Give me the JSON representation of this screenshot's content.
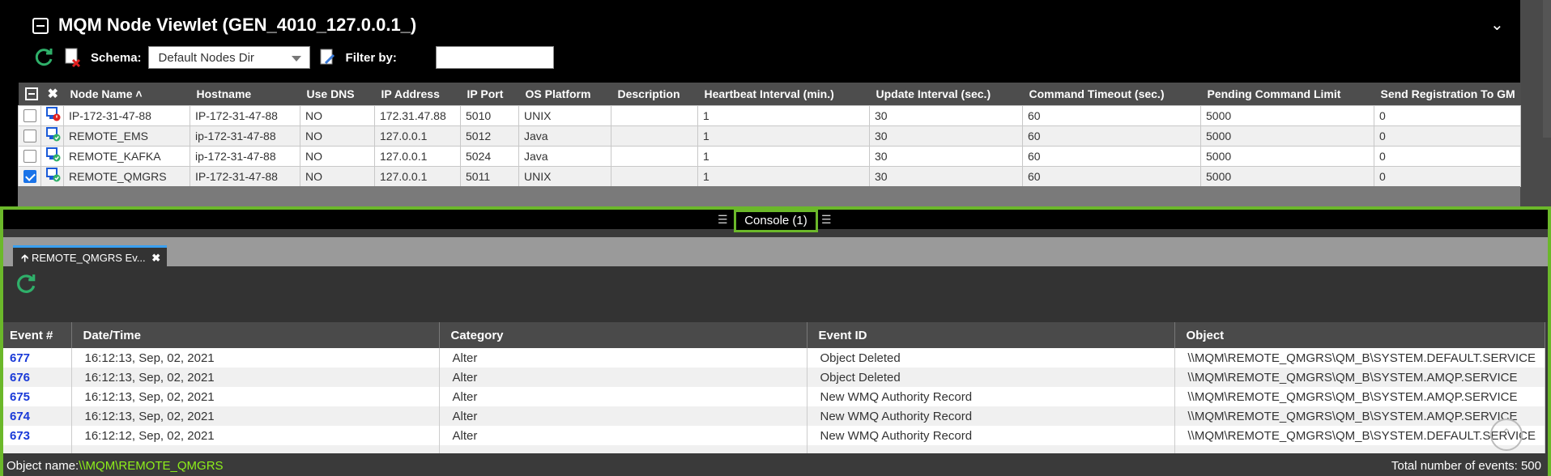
{
  "viewlet": {
    "title": "MQM Node Viewlet (GEN_4010_127.0.0.1_)",
    "schema_label": "Schema:",
    "schema_value": "Default Nodes Dir",
    "filter_label": "Filter by:",
    "filter_value": ""
  },
  "nodes": {
    "columns": [
      "Node Name ˄",
      "Hostname",
      "Use DNS",
      "IP Address",
      "IP Port",
      "OS Platform",
      "Description",
      "Heartbeat Interval (min.)",
      "Update Interval (sec.)",
      "Command Timeout (sec.)",
      "Pending Command Limit",
      "Send Registration To GM"
    ],
    "rows": [
      {
        "checked": false,
        "status": "error",
        "name": "IP-172-31-47-88",
        "host": "IP-172-31-47-88",
        "dns": "NO",
        "ip": "172.31.47.88",
        "port": "5010",
        "os": "UNIX",
        "desc": "",
        "hb": "1",
        "upd": "30",
        "cmd": "60",
        "pend": "5000",
        "reg": "0"
      },
      {
        "checked": false,
        "status": "ok",
        "name": "REMOTE_EMS",
        "host": "ip-172-31-47-88",
        "dns": "NO",
        "ip": "127.0.0.1",
        "port": "5012",
        "os": "Java",
        "desc": "",
        "hb": "1",
        "upd": "30",
        "cmd": "60",
        "pend": "5000",
        "reg": "0"
      },
      {
        "checked": false,
        "status": "ok",
        "name": "REMOTE_KAFKA",
        "host": "ip-172-31-47-88",
        "dns": "NO",
        "ip": "127.0.0.1",
        "port": "5024",
        "os": "Java",
        "desc": "",
        "hb": "1",
        "upd": "30",
        "cmd": "60",
        "pend": "5000",
        "reg": "0"
      },
      {
        "checked": true,
        "status": "ok",
        "name": "REMOTE_QMGRS",
        "host": "IP-172-31-47-88",
        "dns": "NO",
        "ip": "127.0.0.1",
        "port": "5011",
        "os": "UNIX",
        "desc": "",
        "hb": "1",
        "upd": "30",
        "cmd": "60",
        "pend": "5000",
        "reg": "0"
      }
    ]
  },
  "console": {
    "tab_label": "Console (1)",
    "event_tab_label": "REMOTE_QMGRS Ev...",
    "columns": [
      "Event #",
      "Date/Time",
      "Category",
      "Event ID",
      "Object"
    ],
    "events": [
      {
        "num": "677",
        "dt": "16:12:13, Sep, 02, 2021",
        "cat": "Alter",
        "eid": "Object Deleted",
        "obj": "\\\\MQM\\REMOTE_QMGRS\\QM_B\\SYSTEM.DEFAULT.SERVICE"
      },
      {
        "num": "676",
        "dt": "16:12:13, Sep, 02, 2021",
        "cat": "Alter",
        "eid": "Object Deleted",
        "obj": "\\\\MQM\\REMOTE_QMGRS\\QM_B\\SYSTEM.AMQP.SERVICE"
      },
      {
        "num": "675",
        "dt": "16:12:13, Sep, 02, 2021",
        "cat": "Alter",
        "eid": "New WMQ Authority Record",
        "obj": "\\\\MQM\\REMOTE_QMGRS\\QM_B\\SYSTEM.AMQP.SERVICE"
      },
      {
        "num": "674",
        "dt": "16:12:13, Sep, 02, 2021",
        "cat": "Alter",
        "eid": "New WMQ Authority Record",
        "obj": "\\\\MQM\\REMOTE_QMGRS\\QM_B\\SYSTEM.AMQP.SERVICE"
      },
      {
        "num": "673",
        "dt": "16:12:12, Sep, 02, 2021",
        "cat": "Alter",
        "eid": "New WMQ Authority Record",
        "obj": "\\\\MQM\\REMOTE_QMGRS\\QM_B\\SYSTEM.DEFAULT.SERVICE"
      }
    ],
    "status_prefix": "Object name:",
    "status_path": "\\\\MQM\\REMOTE_QMGRS",
    "total": "Total number of events: 500"
  },
  "colors": {
    "accent": "#6bb82a",
    "link": "#1a3ad8",
    "refresh": "#2fb06a"
  }
}
